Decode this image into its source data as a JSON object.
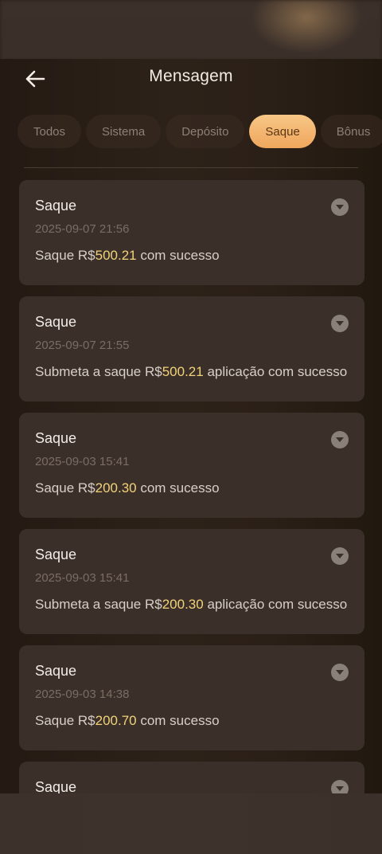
{
  "header": {
    "title": "Mensagem",
    "back_icon": "arrow-left-icon"
  },
  "tabs": [
    {
      "label": "Todos",
      "active": false
    },
    {
      "label": "Sistema",
      "active": false
    },
    {
      "label": "Depósito",
      "active": false
    },
    {
      "label": "Saque",
      "active": true
    },
    {
      "label": "Bônus",
      "active": false
    }
  ],
  "messages": [
    {
      "title": "Saque",
      "date": "2025-09-07 21:56",
      "prefix": "Saque R$",
      "amount": "500.21",
      "suffix": " com sucesso"
    },
    {
      "title": "Saque",
      "date": "2025-09-07 21:55",
      "prefix": "Submeta a saque R$",
      "amount": "500.21",
      "suffix": " aplicação com sucesso"
    },
    {
      "title": "Saque",
      "date": "2025-09-03 15:41",
      "prefix": "Saque R$",
      "amount": "200.30",
      "suffix": " com sucesso"
    },
    {
      "title": "Saque",
      "date": "2025-09-03 15:41",
      "prefix": "Submeta a saque R$",
      "amount": "200.30",
      "suffix": " aplicação com sucesso"
    },
    {
      "title": "Saque",
      "date": "2025-09-03 14:38",
      "prefix": "Saque R$",
      "amount": "200.70",
      "suffix": " com sucesso"
    },
    {
      "title": "Saque"
    }
  ],
  "colors": {
    "accent": "#efa65d",
    "amount": "#f2d37a",
    "card": "#3a2f29"
  }
}
